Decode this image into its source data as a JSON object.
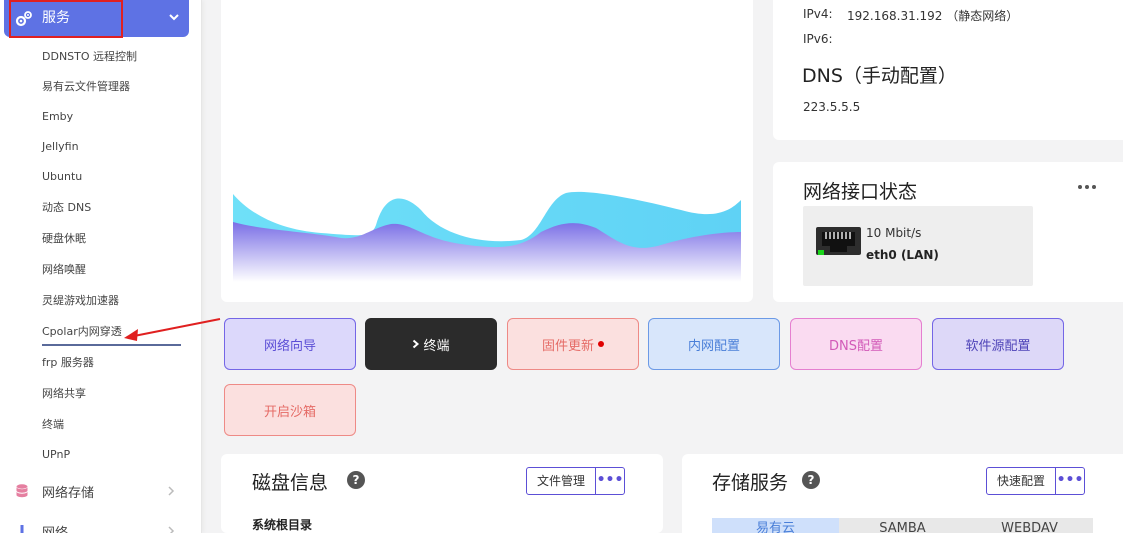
{
  "sidebar": {
    "services_label": "服务",
    "sub_items": [
      "DDNSTO 远程控制",
      "易有云文件管理器",
      "Emby",
      "Jellyfin",
      "Ubuntu",
      "动态 DNS",
      "硬盘休眠",
      "网络唤醒",
      "灵缇游戏加速器",
      "Cpolar内网穿透",
      "frp 服务器",
      "网络共享",
      "终端",
      "UPnP"
    ],
    "network_storage_label": "网络存储",
    "network_label": "网络"
  },
  "net_info": {
    "ipv4_label": "IPv4:",
    "ipv4_value": "192.168.31.192 （静态网络）",
    "ipv6_label": "IPv6:",
    "dns_title": "DNS（手动配置）",
    "dns_value": "223.5.5.5"
  },
  "iface": {
    "title": "网络接口状态",
    "speed": "10 Mbit/s",
    "name": "eth0 (LAN)"
  },
  "quick": {
    "wizard": "网络向导",
    "terminal": "终端",
    "firmware": "固件更新",
    "lan": "内网配置",
    "dns": "DNS配置",
    "source": "软件源配置",
    "sandbox": "开启沙箱"
  },
  "disk": {
    "title": "磁盘信息",
    "manage_button": "文件管理",
    "root_label": "系统根目录"
  },
  "storage": {
    "title": "存储服务",
    "quick_config": "快速配置",
    "tabs": [
      "易有云",
      "SAMBA",
      "WEBDAV"
    ]
  },
  "colors": {
    "accent": "#5e72e4",
    "annotation": "#e02020"
  }
}
